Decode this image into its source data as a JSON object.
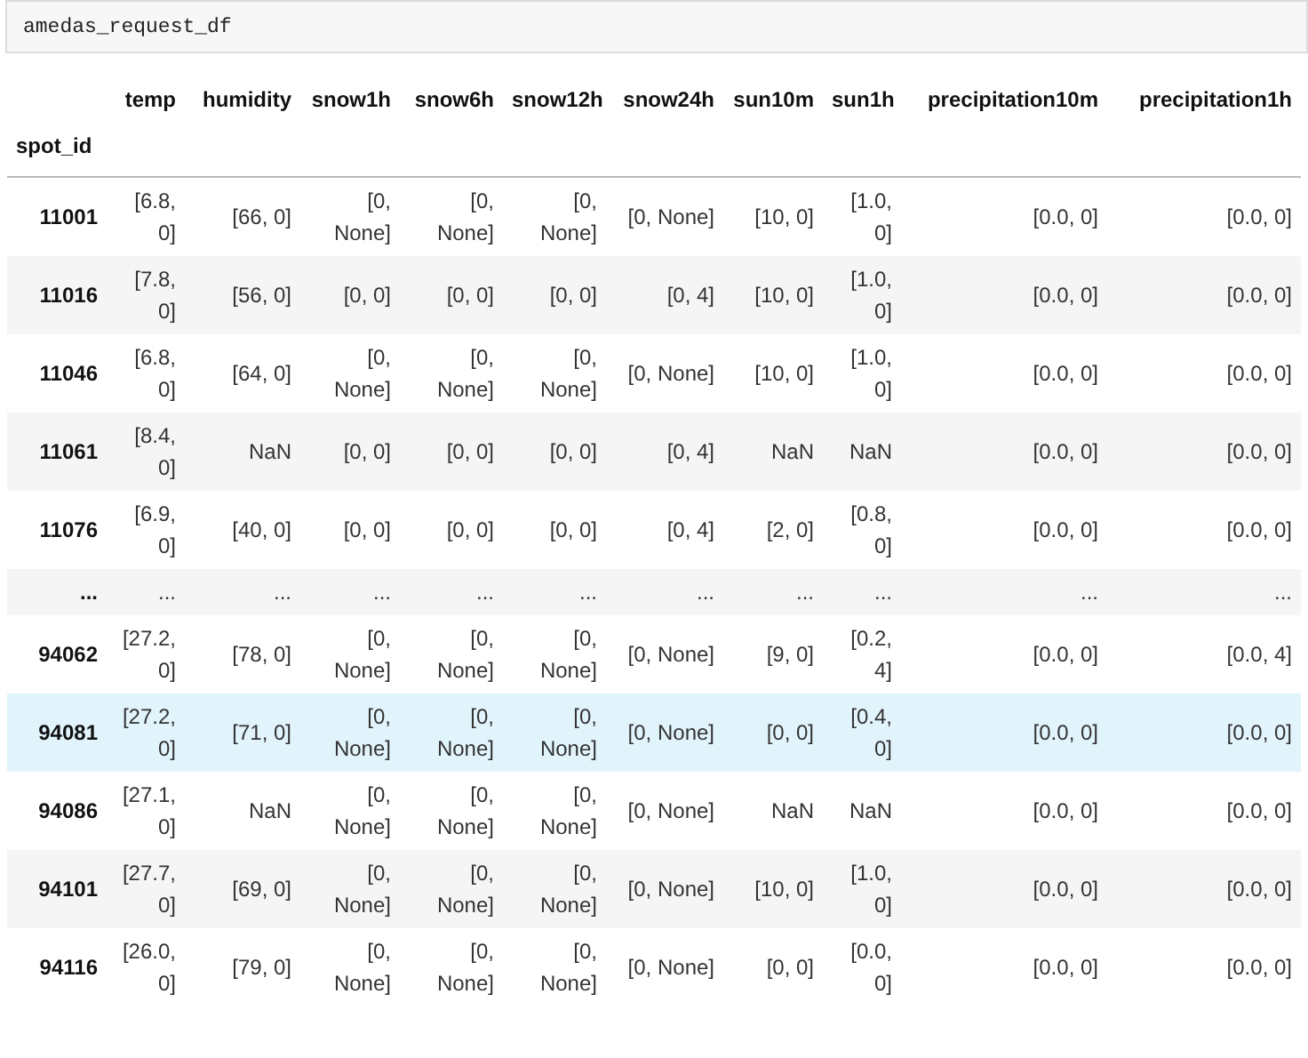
{
  "code_cell": {
    "code": "amedas_request_df"
  },
  "table": {
    "columns": [
      "temp",
      "humidity",
      "snow1h",
      "snow6h",
      "snow12h",
      "snow24h",
      "sun10m",
      "sun1h",
      "precipitation10m",
      "precipitation1h"
    ],
    "index_name": "spot_id",
    "rows": [
      {
        "index": "11001",
        "selected": false,
        "cells": [
          "[6.8, 0]",
          "[66, 0]",
          "[0, None]",
          "[0, None]",
          "[0, None]",
          "[0, None]",
          "[10, 0]",
          "[1.0, 0]",
          "[0.0, 0]",
          "[0.0, 0]"
        ]
      },
      {
        "index": "11016",
        "selected": false,
        "cells": [
          "[7.8, 0]",
          "[56, 0]",
          "[0, 0]",
          "[0, 0]",
          "[0, 0]",
          "[0, 4]",
          "[10, 0]",
          "[1.0, 0]",
          "[0.0, 0]",
          "[0.0, 0]"
        ]
      },
      {
        "index": "11046",
        "selected": false,
        "cells": [
          "[6.8, 0]",
          "[64, 0]",
          "[0, None]",
          "[0, None]",
          "[0, None]",
          "[0, None]",
          "[10, 0]",
          "[1.0, 0]",
          "[0.0, 0]",
          "[0.0, 0]"
        ]
      },
      {
        "index": "11061",
        "selected": false,
        "cells": [
          "[8.4, 0]",
          "NaN",
          "[0, 0]",
          "[0, 0]",
          "[0, 0]",
          "[0, 4]",
          "NaN",
          "NaN",
          "[0.0, 0]",
          "[0.0, 0]"
        ]
      },
      {
        "index": "11076",
        "selected": false,
        "cells": [
          "[6.9, 0]",
          "[40, 0]",
          "[0, 0]",
          "[0, 0]",
          "[0, 0]",
          "[0, 4]",
          "[2, 0]",
          "[0.8, 0]",
          "[0.0, 0]",
          "[0.0, 0]"
        ]
      },
      {
        "index": "...",
        "selected": false,
        "cells": [
          "...",
          "...",
          "...",
          "...",
          "...",
          "...",
          "...",
          "...",
          "...",
          "..."
        ]
      },
      {
        "index": "94062",
        "selected": false,
        "cells": [
          "[27.2, 0]",
          "[78, 0]",
          "[0, None]",
          "[0, None]",
          "[0, None]",
          "[0, None]",
          "[9, 0]",
          "[0.2, 4]",
          "[0.0, 0]",
          "[0.0, 4]"
        ]
      },
      {
        "index": "94081",
        "selected": true,
        "cells": [
          "[27.2, 0]",
          "[71, 0]",
          "[0, None]",
          "[0, None]",
          "[0, None]",
          "[0, None]",
          "[0, 0]",
          "[0.4, 0]",
          "[0.0, 0]",
          "[0.0, 0]"
        ]
      },
      {
        "index": "94086",
        "selected": false,
        "cells": [
          "[27.1, 0]",
          "NaN",
          "[0, None]",
          "[0, None]",
          "[0, None]",
          "[0, None]",
          "NaN",
          "NaN",
          "[0.0, 0]",
          "[0.0, 0]"
        ]
      },
      {
        "index": "94101",
        "selected": false,
        "cells": [
          "[27.7, 0]",
          "[69, 0]",
          "[0, None]",
          "[0, None]",
          "[0, None]",
          "[0, None]",
          "[10, 0]",
          "[1.0, 0]",
          "[0.0, 0]",
          "[0.0, 0]"
        ]
      },
      {
        "index": "94116",
        "selected": false,
        "cells": [
          "[26.0, 0]",
          "[79, 0]",
          "[0, None]",
          "[0, None]",
          "[0, None]",
          "[0, None]",
          "[0, 0]",
          "[0.0, 0]",
          "[0.0, 0]",
          "[0.0, 0]"
        ]
      }
    ]
  }
}
